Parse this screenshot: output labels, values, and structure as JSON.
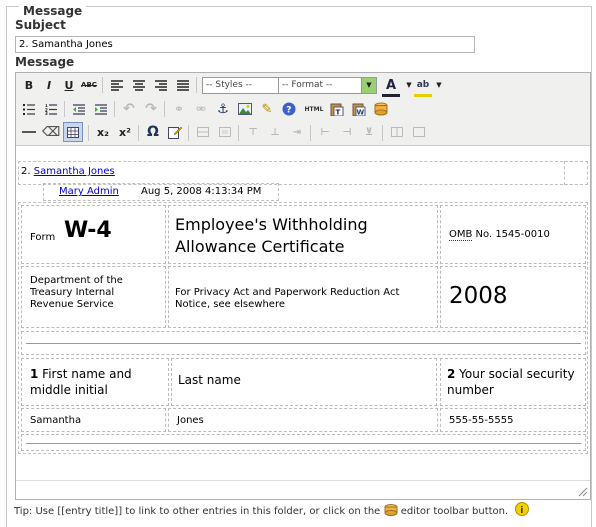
{
  "fieldset": {
    "legend": "Message"
  },
  "subject": {
    "label": "Subject",
    "value": "2. Samantha Jones"
  },
  "message": {
    "label": "Message"
  },
  "toolbar": {
    "styles_select": "-- Styles --",
    "format_select": "-- Format --",
    "html_label": "HTML"
  },
  "content": {
    "entry_number": "2.",
    "entry_link": "Samantha Jones",
    "author_link": "Mary Admin",
    "timestamp": "Aug 5, 2008 4:13:34 PM",
    "form_prefix": "Form",
    "form_name": "W-4",
    "title_line1": "Employee's Withholding",
    "title_line2": "Allowance Certificate",
    "omb_abbr": "OMB",
    "omb_rest": " No. 1545-0010",
    "dept": "Department of the Treasury Internal Revenue Service",
    "privacy": "For Privacy Act and Paperwork Reduction Act Notice, see elsewhere",
    "year": "2008",
    "field1_num": "1",
    "field1_label": " First name and middle initial",
    "field_last": "Last name",
    "field2_num": "2",
    "field2_label": " Your social security number",
    "first_name": "Samantha",
    "last_name": "Jones",
    "ssn": "555-55-5555"
  },
  "tip": "Tip: Use [[entry title]] to link to other entries in this folder, or click on the",
  "tip_end": "editor toolbar button."
}
